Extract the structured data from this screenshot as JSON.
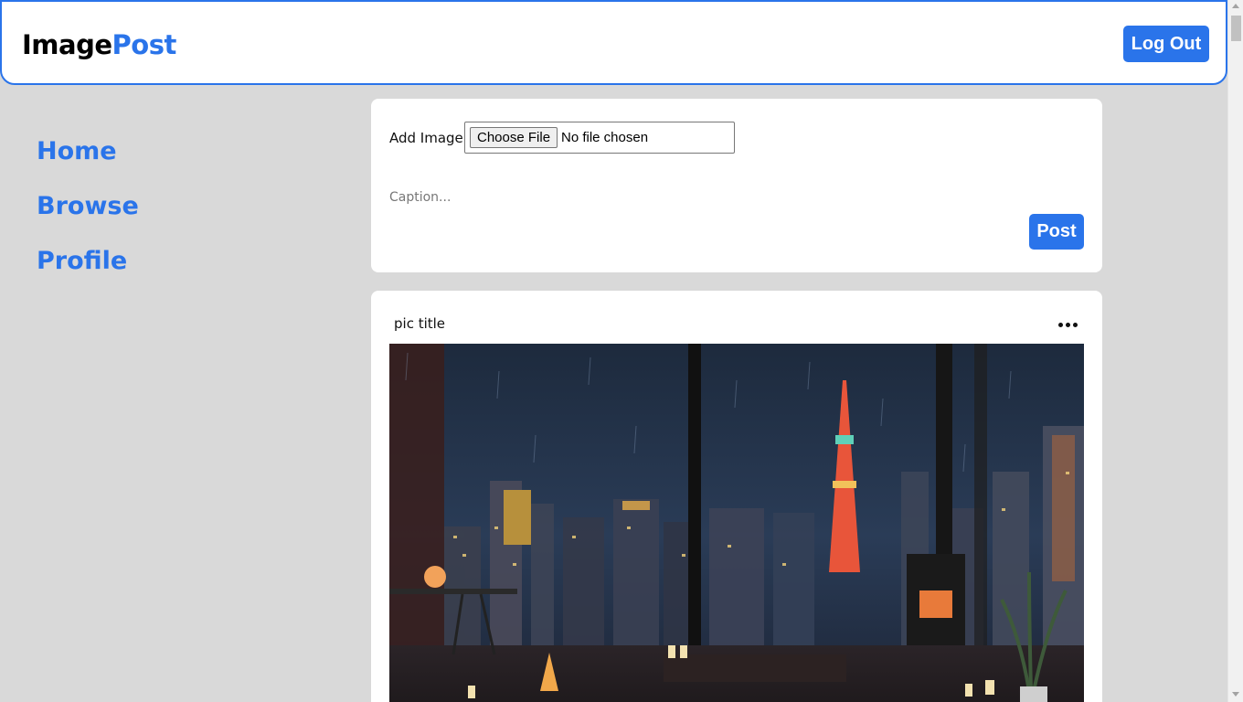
{
  "header": {
    "logo_part1": "Image",
    "logo_part2": "Post",
    "logout_label": "Log Out"
  },
  "sidebar": {
    "items": [
      {
        "label": "Home"
      },
      {
        "label": "Browse"
      },
      {
        "label": "Profile"
      }
    ]
  },
  "upload": {
    "add_image_label": "Add Image",
    "choose_file_label": "Choose File",
    "no_file_text": "No file chosen",
    "caption_placeholder": "Caption...",
    "post_label": "Post"
  },
  "post": {
    "title": "pic title",
    "more_icon": "ellipsis-icon"
  },
  "colors": {
    "accent": "#2a74ea",
    "background": "#d9d9d9"
  }
}
